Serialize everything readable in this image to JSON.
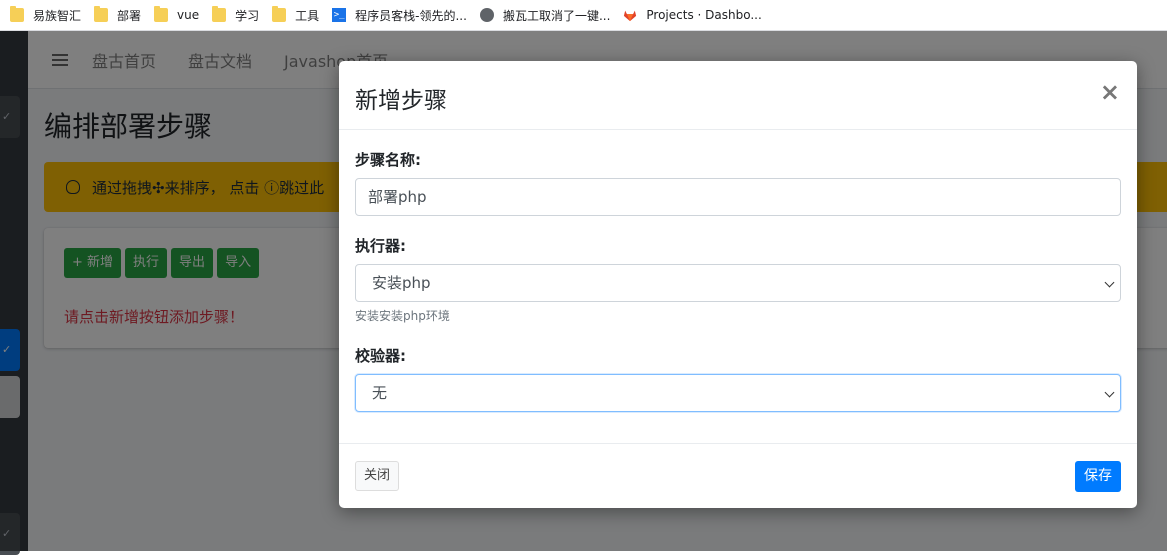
{
  "bookmarks": [
    {
      "label": "易族智汇",
      "icon": "folder-icon"
    },
    {
      "label": "部署",
      "icon": "folder-icon"
    },
    {
      "label": "vue",
      "icon": "folder-icon"
    },
    {
      "label": "学习",
      "icon": "folder-icon"
    },
    {
      "label": "工具",
      "icon": "folder-icon"
    },
    {
      "label": "程序员客栈-领先的...",
      "icon": "terminal-icon"
    },
    {
      "label": "搬瓦工取消了一键...",
      "icon": "globe-icon"
    },
    {
      "label": "Projects · Dashbo...",
      "icon": "gitlab-icon"
    }
  ],
  "nav": {
    "links": [
      "盘古首页",
      "盘古文档",
      "Javashop首页"
    ]
  },
  "page": {
    "title": "编排部署步骤",
    "alert_text": "通过拖拽✣来排序， 点击 ⓘ跳过此",
    "buttons": [
      "+ 新增",
      "执行",
      "导出",
      "导入"
    ],
    "empty_hint": "请点击新增按钮添加步骤！"
  },
  "modal": {
    "title": "新增步骤",
    "close_symbol": "×",
    "step_name_label": "步骤名称:",
    "step_name_value": "部署php",
    "executor_label": "执行器:",
    "executor_value": "安装php",
    "executor_help": "安装安装php环境",
    "validator_label": "校验器:",
    "validator_value": "无",
    "close_button": "关闭",
    "save_button": "保存"
  },
  "colors": {
    "primary": "#007bff",
    "success": "#28a745",
    "warning": "#ffc107",
    "danger": "#dc3545",
    "sidebar": "#343a40"
  }
}
